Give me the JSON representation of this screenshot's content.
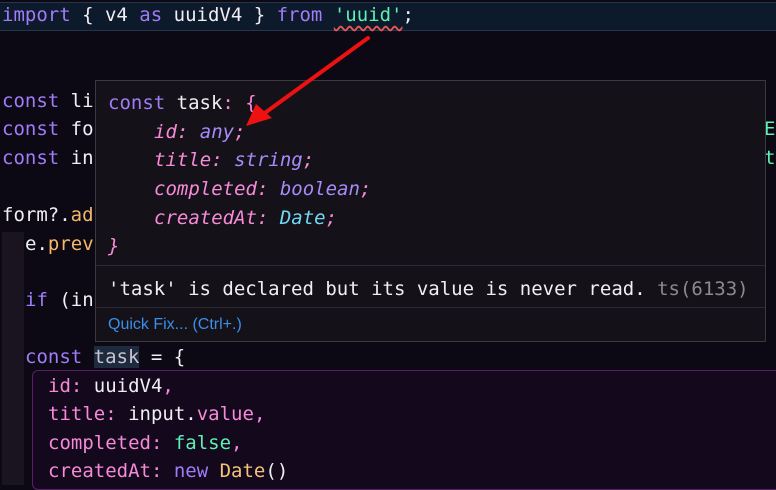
{
  "editor": {
    "import_line": {
      "kw1": "import",
      "brace_open": " { ",
      "name": "v4",
      "as": " as ",
      "alias": "uuidV4",
      "brace_close": " } ",
      "from": "from",
      "module": "'uuid'",
      "semi": ";"
    },
    "line_const_li": {
      "kw": "const",
      "rest": " li"
    },
    "line_const_fo": {
      "kw": "const",
      "rest": " fo",
      "tail": "E"
    },
    "line_const_in": {
      "kw": "const",
      "rest": " in",
      "tail": "t"
    },
    "line_form": {
      "obj": "form?.",
      "method": "ad"
    },
    "line_prevent": {
      "obj": "e.",
      "method": "prev"
    },
    "line_if": {
      "kw": "if",
      "rest": " (in"
    },
    "line_task": {
      "kw": "const",
      "name": "task",
      "rest": " = {"
    },
    "task_props": [
      {
        "key": "id",
        "sep": ": ",
        "value": "uuidV4",
        "end": ","
      },
      {
        "key": "title",
        "sep": ": ",
        "value": "input.",
        "value2": "value",
        "end": ","
      },
      {
        "key": "completed",
        "sep": ": ",
        "value": "false",
        "end": ","
      },
      {
        "key": "createdAt",
        "sep": ": ",
        "kw": "new ",
        "value": "Date",
        "end": "()"
      }
    ]
  },
  "hover": {
    "decl_kw": "const",
    "decl_name": " task",
    "decl_colon": ": {",
    "fields": [
      {
        "name": "id",
        "type": "any"
      },
      {
        "name": "title",
        "type": "string"
      },
      {
        "name": "completed",
        "type": "boolean"
      },
      {
        "name": "createdAt",
        "type": "Date"
      }
    ],
    "close": "}",
    "message": "'task' is declared but its value is never read.",
    "code": "ts(6133)",
    "quick_fix": "Quick Fix... (Ctrl+.)"
  },
  "colors": {
    "annotation_arrow": "#ee1111",
    "keyword": "#a07cf7",
    "string": "#5ef0b4",
    "property": "#f68ad8",
    "link": "#3b8eea"
  }
}
